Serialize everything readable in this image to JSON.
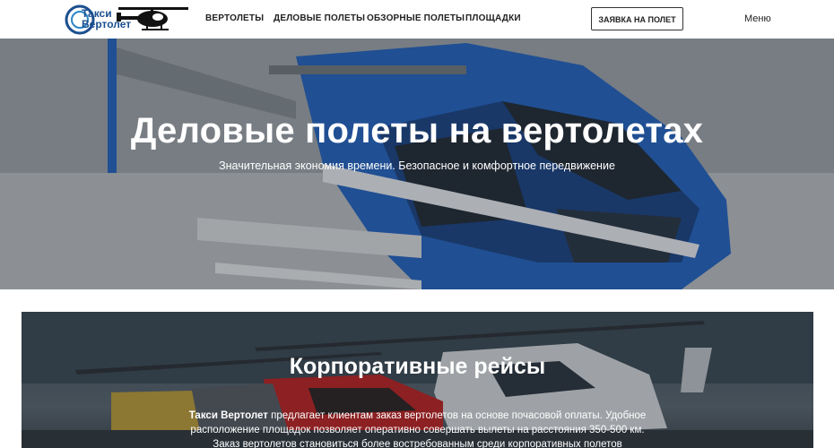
{
  "header": {
    "logo": {
      "line1": "Такси",
      "line2": "Вертолет"
    },
    "nav": [
      "ВЕРТОЛЕТЫ",
      "ДЕЛОВЫЕ ПОЛЕТЫ",
      "ОБЗОРНЫЕ ПОЛЕТЫ",
      "ПЛОЩАДКИ"
    ],
    "cta_label": "ЗАЯВКА НА ПОЛЕТ",
    "menu_label": "Меню"
  },
  "hero": {
    "title": "Деловые полеты на вертолетах",
    "subtitle": "Значительная экономия времени. Безопасное и комфортное передвижение"
  },
  "section2": {
    "title": "Корпоративные рейсы",
    "text_bold": "Такси Вертолет",
    "text_rest": " предлагает клиентам заказ вертолетов на основе почасовой оплаты. Удобное расположение площадок позволяет оперативно совершать вылеты на расстояния 350-500 км.",
    "text_line3": "Заказ вертолетов становиться более востребованным среди корпоративных полетов"
  },
  "colors": {
    "brand": "#1b4f8f",
    "helicopter_blue": "#1d5fbd",
    "cta_border": "#333333"
  }
}
